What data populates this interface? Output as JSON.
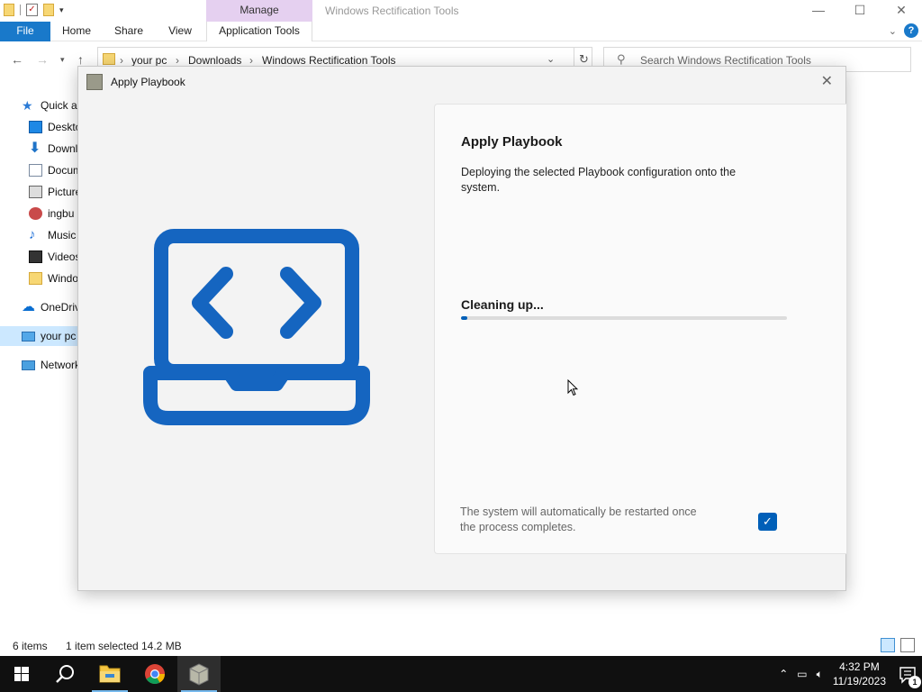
{
  "explorer": {
    "title": "Windows Rectification Tools",
    "manage_tab": "Manage",
    "window_controls": {
      "minimize": "—",
      "maximize": "☐",
      "close": "✕"
    },
    "ribbon_tabs": {
      "file": "File",
      "home": "Home",
      "share": "Share",
      "view": "View",
      "app_tools": "Application Tools"
    },
    "breadcrumb": [
      "your pc",
      "Downloads",
      "Windows Rectification Tools"
    ],
    "search_placeholder": "Search Windows Rectification Tools",
    "nav_items": {
      "quick_access": "Quick access",
      "desktop": "Desktop",
      "downloads": "Downloads",
      "documents": "Documents",
      "pictures": "Pictures",
      "ingbu": "ingbu",
      "music": "Music",
      "videos": "Videos",
      "windows_folder": "Windows Rectification Tools",
      "onedrive": "OneDrive",
      "your_pc": "your pc",
      "network": "Network"
    },
    "status": {
      "items": "6 items",
      "selected": "1 item selected",
      "size": "14.2 MB"
    }
  },
  "dialog": {
    "title": "Apply Playbook",
    "close_glyph": "✕",
    "heading": "Apply Playbook",
    "description": "Deploying the selected Playbook configuration onto the system.",
    "status_text": "Cleaning up...",
    "progress": 0.02,
    "restart_note": "The system will automatically be restarted once the process completes.",
    "restart_checked": true
  },
  "taskbar": {
    "time": "4:32 PM",
    "date": "11/19/2023",
    "notification_count": "1",
    "apps": [
      "file-explorer",
      "chrome",
      "playbook-app"
    ]
  },
  "colors": {
    "accent": "#005fb8",
    "file_tab": "#1979ca",
    "manage_tab": "#e5d0f0",
    "illustration": "#1565c0",
    "selection": "#cce8ff"
  }
}
